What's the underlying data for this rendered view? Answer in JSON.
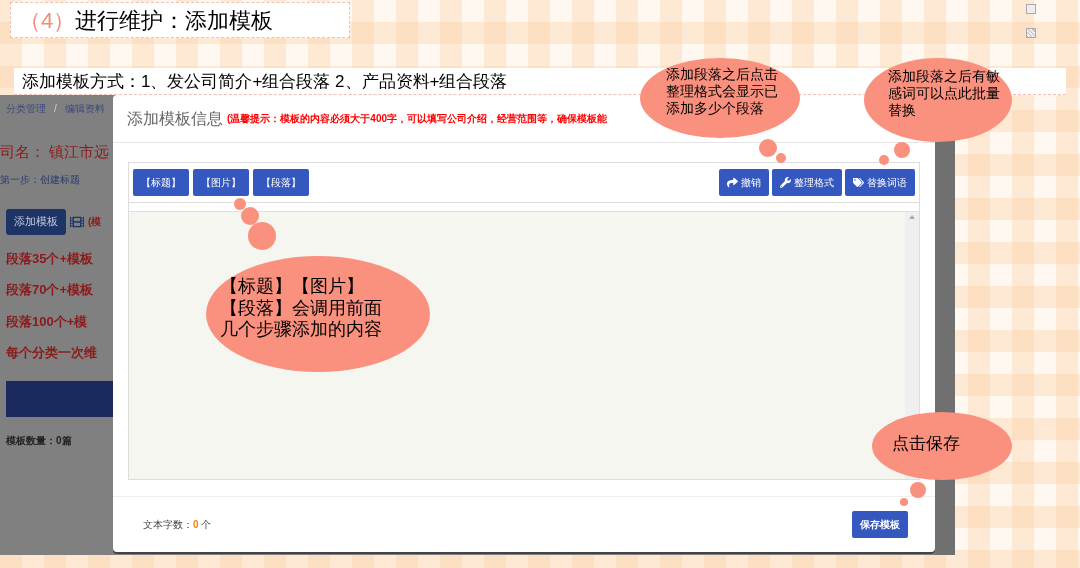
{
  "slide_title": {
    "number": "（4）",
    "text": "进行维护：添加模板"
  },
  "subtitle": "添加模板方式：1、发公司简介+组合段落  2、产品资料+组合段落",
  "background_page": {
    "breadcrumb": [
      "分类管理",
      "/",
      "编辑资料"
    ],
    "company": "司名：  镇江市远",
    "step": "第一步：创建标题",
    "add_button": "添加模板",
    "note": "(模",
    "items": [
      "段落35个+模板",
      "段落70个+模板",
      "段落100个+模",
      "每个分类一次维"
    ],
    "count": "模板数量：0篇"
  },
  "modal": {
    "title": "添加模板信息",
    "tip": "(温馨提示：模板的内容必须大于400字，可以填写公司介绍，经营范围等，确保模板能",
    "toolbar_left": [
      "【标题】",
      "【图片】",
      "【段落】"
    ],
    "toolbar_right": [
      {
        "kind": "undo",
        "label": "撤销"
      },
      {
        "kind": "format",
        "label": "整理格式"
      },
      {
        "kind": "replace",
        "label": "替换词语"
      }
    ],
    "word_count": {
      "label": "文本字数：",
      "value": "0",
      "unit": "个"
    },
    "save": "保存模板"
  },
  "callouts": [
    {
      "lines": [
        "添加段落之后点击",
        "整理格式会显示已",
        "添加多少个段落"
      ]
    },
    {
      "lines": [
        "添加段落之后有敏",
        "感词可以点此批量",
        "替换"
      ]
    },
    {
      "lines": [
        "【标题】【图片】",
        "【段落】会调用前面",
        "几个步骤添加的内容"
      ]
    },
    {
      "lines": [
        "点击保存"
      ]
    }
  ]
}
